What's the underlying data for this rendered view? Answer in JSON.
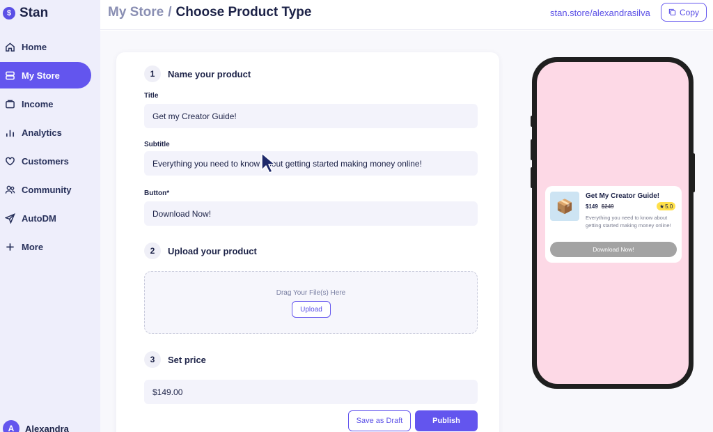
{
  "brand": {
    "logo_glyph": "$",
    "name": "Stan"
  },
  "sidebar": {
    "items": [
      {
        "label": "Home",
        "icon": "home-icon"
      },
      {
        "label": "My Store",
        "icon": "store-icon",
        "active": true
      },
      {
        "label": "Income",
        "icon": "wallet-icon"
      },
      {
        "label": "Analytics",
        "icon": "bar-chart-icon"
      },
      {
        "label": "Customers",
        "icon": "heart-icon"
      },
      {
        "label": "Community",
        "icon": "users-icon"
      },
      {
        "label": "AutoDM",
        "icon": "send-icon"
      },
      {
        "label": "More",
        "icon": "plus-icon"
      }
    ],
    "user": {
      "initial": "A",
      "name": "Alexandra"
    }
  },
  "header": {
    "breadcrumb_parent": "My Store",
    "breadcrumb_separator": "/",
    "title": "Choose Product Type",
    "store_url": "stan.store/alexandrasilva",
    "copy_label": "Copy"
  },
  "form": {
    "step1": {
      "number": "1",
      "title": "Name your product"
    },
    "title_label": "Title",
    "title_value": "Get my Creator Guide!",
    "subtitle_label": "Subtitle",
    "subtitle_value": "Everything you need to know about getting started making money online!",
    "button_label": "Button*",
    "button_value": "Download Now!",
    "step2": {
      "number": "2",
      "title": "Upload your product"
    },
    "drop_text": "Drag Your File(s) Here",
    "upload_label": "Upload",
    "step3": {
      "number": "3",
      "title": "Set price"
    },
    "price_value": "$149.00",
    "draft_label": "Save as Draft",
    "publish_label": "Publish"
  },
  "preview": {
    "title": "Get My Creator Guide!",
    "price": "$149",
    "old_price": "$249",
    "rating": "5.0",
    "rating_icon": "star-icon",
    "description": "Everything you need to know about getting started making money online!",
    "button_label": "Download Now!",
    "background_color": "#fdd9e6"
  },
  "colors": {
    "accent": "#6355ee",
    "text": "#1c2247",
    "muted": "#8a8fb3"
  }
}
